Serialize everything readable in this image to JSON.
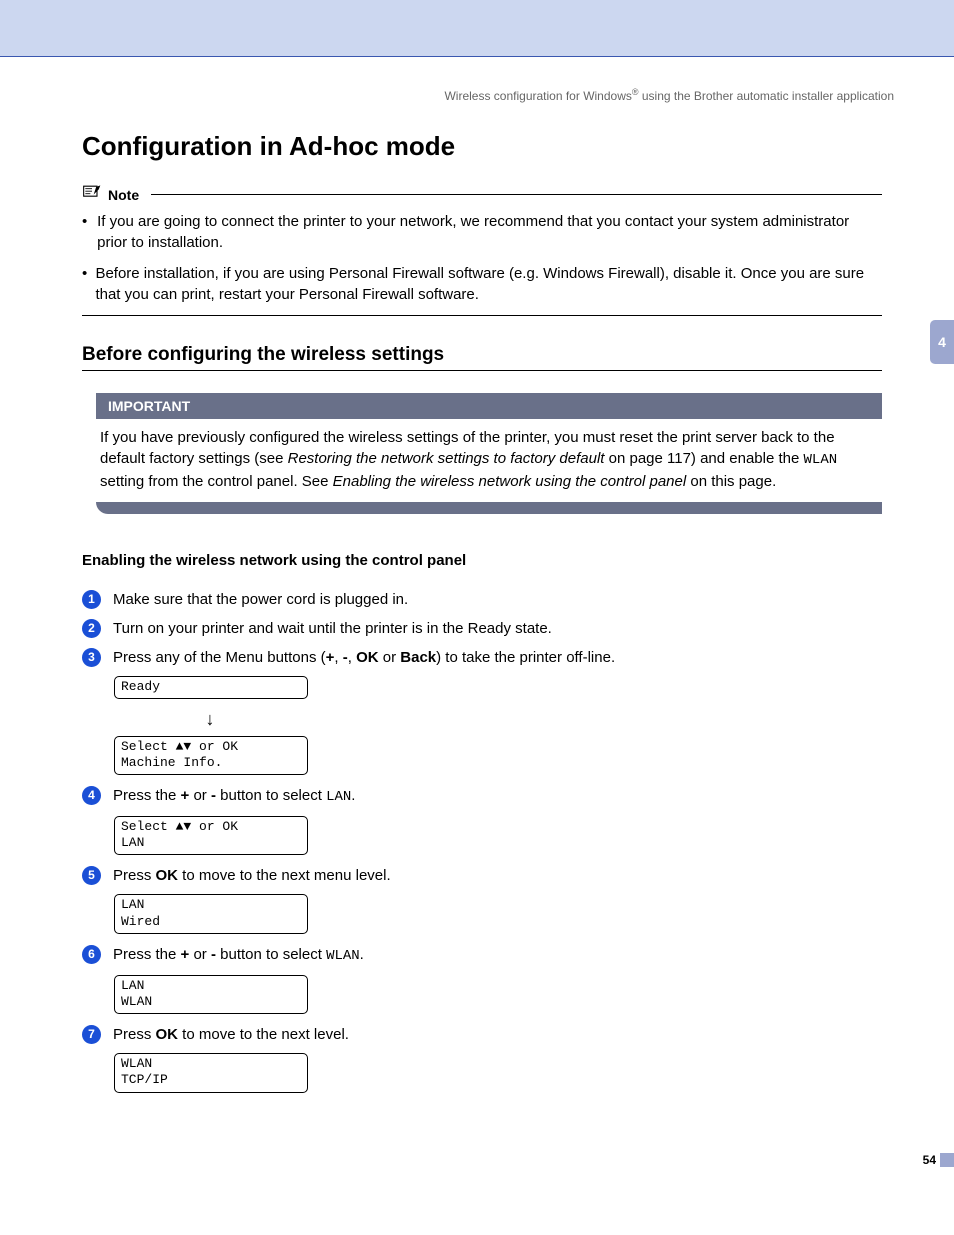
{
  "header": {
    "pre": "Wireless configuration for Windows",
    "sup": "®",
    "post": " using the Brother automatic installer application"
  },
  "chapter_tab": "4",
  "h1": "Configuration in Ad-hoc mode",
  "note": {
    "label": "Note",
    "items": [
      "If you are going to connect the printer to your network, we recommend that you contact your system administrator prior to installation.",
      "Before installation, if you are using Personal Firewall software (e.g. Windows Firewall), disable it. Once you are sure that you can print, restart your Personal Firewall software."
    ]
  },
  "h2": "Before configuring the wireless settings",
  "important": {
    "label": "IMPORTANT",
    "body_pre": "If you have previously configured the wireless settings of the printer, you must reset the print server back to the default factory settings (see ",
    "body_it1": "Restoring the network settings to factory default",
    "body_mid1": " on page 117) and enable the ",
    "body_mono": "WLAN",
    "body_mid2": " setting from the control panel. See ",
    "body_it2": "Enabling the wireless network using the control panel",
    "body_post": " on this page."
  },
  "h3": "Enabling the wireless network using the control panel",
  "steps": {
    "s1": "Make sure that the power cord is plugged in.",
    "s2": "Turn on your printer and wait until the printer is in the Ready state.",
    "s3_pre": "Press any of the Menu buttons (",
    "s3_plus": "+",
    "s3_c1": ", ",
    "s3_minus": "-",
    "s3_c2": ", ",
    "s3_ok": "OK",
    "s3_c3": " or ",
    "s3_back": "Back",
    "s3_post": ") to take the printer off-line.",
    "s4_pre": "Press the ",
    "s4_plus": "+",
    "s4_mid1": " or ",
    "s4_minus": "-",
    "s4_mid2": " button to select ",
    "s4_mono": "LAN",
    "s4_post": ".",
    "s5_pre": "Press ",
    "s5_ok": "OK",
    "s5_post": " to move to the next menu level.",
    "s6_pre": "Press the ",
    "s6_plus": "+",
    "s6_mid1": " or ",
    "s6_minus": "-",
    "s6_mid2": " button to select ",
    "s6_mono": "WLAN",
    "s6_post": ".",
    "s7_pre": "Press ",
    "s7_ok": "OK",
    "s7_post": " to move to the next level."
  },
  "lcd": {
    "l1": "Ready",
    "l2": "Select ▲▼ or OK\nMachine Info.",
    "l3": "Select ▲▼ or OK\nLAN",
    "l4": "LAN\nWired",
    "l5": "LAN\nWLAN",
    "l6": "WLAN\nTCP/IP"
  },
  "page_number": "54"
}
